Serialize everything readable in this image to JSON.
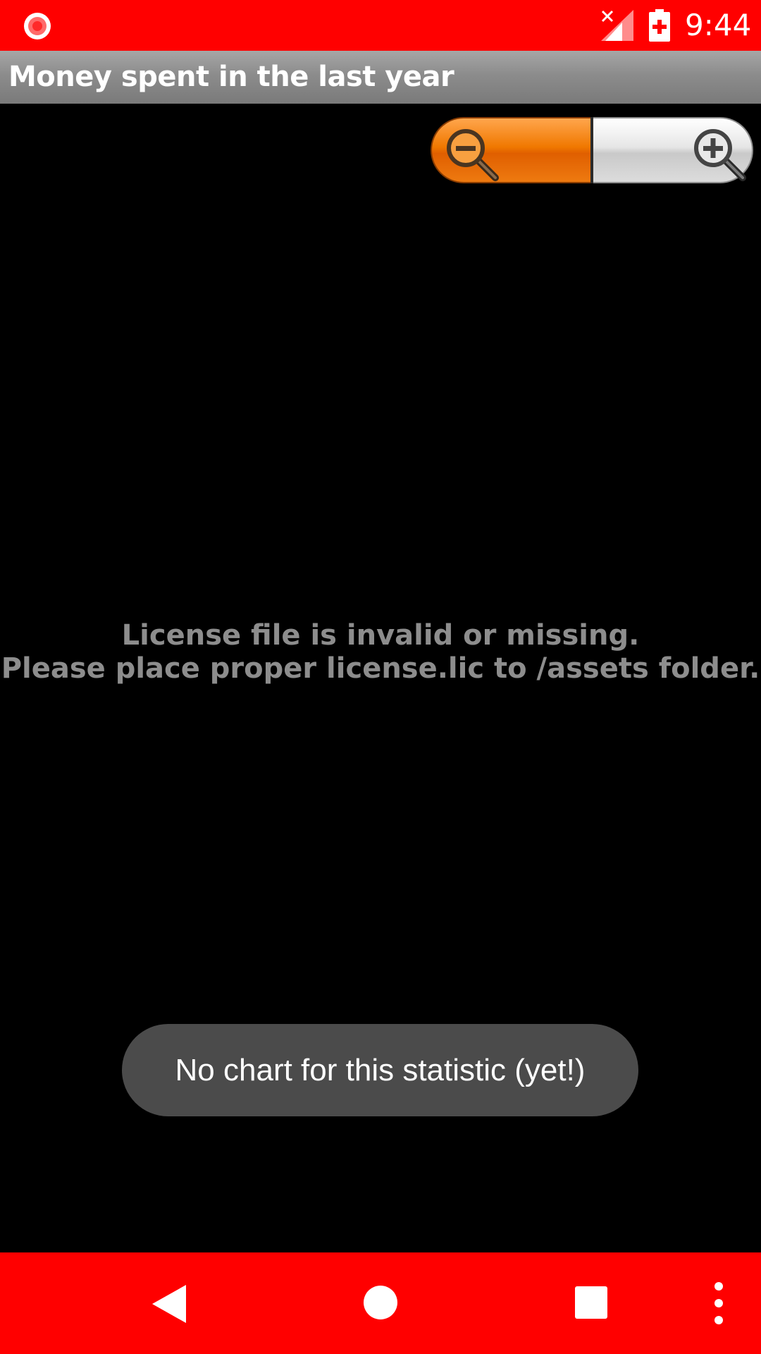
{
  "status_bar": {
    "time": "9:44",
    "icons": [
      "screen-record-icon",
      "signal-no-service-icon",
      "battery-charging-icon"
    ]
  },
  "title_bar": {
    "title": "Money spent in the last year"
  },
  "zoom_control": {
    "zoom_out_icon": "zoom-out-icon",
    "zoom_in_icon": "zoom-in-icon",
    "colors": {
      "zoom_out": "#f07800",
      "zoom_in": "#e0e0e0"
    }
  },
  "license_message": {
    "line1": "License file is invalid or missing.",
    "line2": "Please place proper license.lic to /assets folder."
  },
  "toast": {
    "text": "No chart for this statistic (yet!)"
  },
  "nav_bar": {
    "icons": [
      "back-icon",
      "home-icon",
      "recents-icon",
      "overflow-menu-icon"
    ]
  },
  "colors": {
    "status_bar": "#ff0000",
    "nav_bar": "#ff0000",
    "title_bar": "#8c8c8c",
    "background": "#000000",
    "license_text": "#8d8d8d",
    "toast_background": "#4b4b4b"
  }
}
